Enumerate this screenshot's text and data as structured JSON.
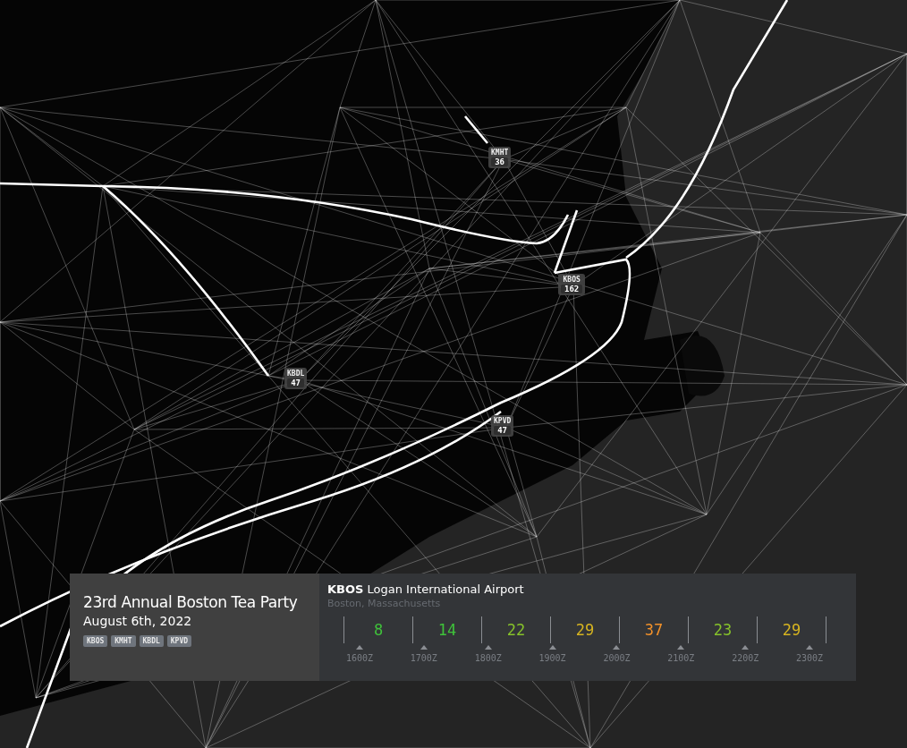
{
  "map_markers": [
    {
      "code": "KMHT",
      "count": "36"
    },
    {
      "code": "KBOS",
      "count": "162"
    },
    {
      "code": "KBDL",
      "count": "47"
    },
    {
      "code": "KPVD",
      "count": "47"
    }
  ],
  "event": {
    "title": "23rd Annual Boston Tea Party",
    "date": "August 6th, 2022",
    "airports": [
      "KBOS",
      "KMHT",
      "KBDL",
      "KPVD"
    ]
  },
  "airport": {
    "code": "KBOS",
    "name": "Logan International Airport",
    "location": "Boston, Massachusetts",
    "hours": [
      {
        "count": "8",
        "color": "#3fc23a"
      },
      {
        "count": "14",
        "color": "#3fc23a"
      },
      {
        "count": "22",
        "color": "#86c22a"
      },
      {
        "count": "29",
        "color": "#d6b420"
      },
      {
        "count": "37",
        "color": "#f0902a"
      },
      {
        "count": "23",
        "color": "#86c22a"
      },
      {
        "count": "29",
        "color": "#d6b420"
      }
    ],
    "ticks": [
      "1600Z",
      "1700Z",
      "1800Z",
      "1900Z",
      "2000Z",
      "2100Z",
      "2200Z",
      "2300Z"
    ]
  }
}
